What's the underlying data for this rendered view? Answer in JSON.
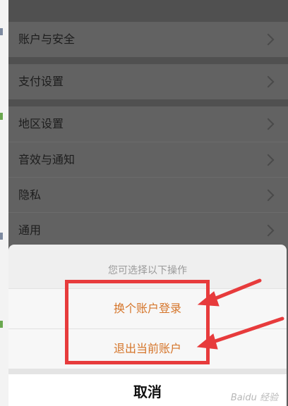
{
  "settings": {
    "items": [
      {
        "label": "账户与安全"
      },
      {
        "label": "支付设置"
      },
      {
        "label": "地区设置"
      },
      {
        "label": "音效与通知"
      },
      {
        "label": "隐私"
      },
      {
        "label": "通用"
      }
    ]
  },
  "action_sheet": {
    "title": "您可选择以下操作",
    "options": [
      {
        "label": "换个账户登录"
      },
      {
        "label": "退出当前账户"
      }
    ],
    "cancel_label": "取消"
  },
  "watermark": "Baidu 经验",
  "colors": {
    "option_text": "#d5752a",
    "highlight": "#e73b3c",
    "overlay_row": "#626262"
  }
}
